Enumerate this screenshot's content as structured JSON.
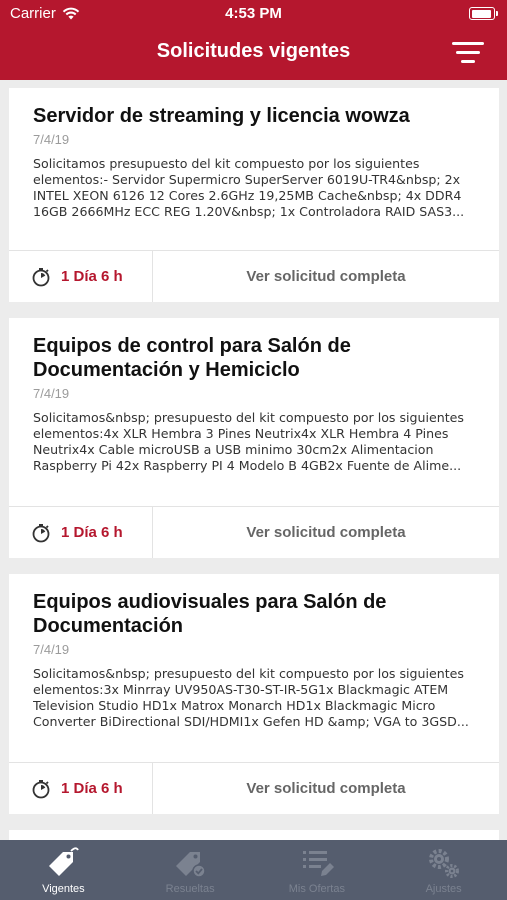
{
  "status_bar": {
    "carrier": "Carrier",
    "time": "4:53 PM",
    "wifi_icon": "wifi-icon",
    "battery_icon": "battery-icon"
  },
  "header": {
    "title": "Solicitudes vigentes",
    "filter_icon": "filter-icon",
    "background": "#b5172e"
  },
  "requests": [
    {
      "title": "Servidor de streaming y licencia wowza",
      "date": "7/4/19",
      "description": "Solicitamos presupuesto del kit compuesto por los siguientes elementos:- Servidor Supermicro SuperServer 6019U-TR4&nbsp; 2x INTEL XEON 6126 12 Cores 2.6GHz 19,25MB Cache&nbsp; 4x DDR4 16GB 2666MHz ECC REG 1.20V&nbsp; 1x Controladora RAID SAS3...",
      "time_left": "1 Día 6 h",
      "action_label": "Ver solicitud completa"
    },
    {
      "title": "Equipos de control para Salón de Documentación y Hemiciclo",
      "date": "7/4/19",
      "description": "Solicitamos&nbsp; presupuesto del kit compuesto por los siguientes elementos:4x XLR Hembra 3 Pines Neutrix4x XLR Hembra 4 Pines Neutrix4x Cable microUSB a USB minimo 30cm2x Alimentacion Raspberry Pi 42x Raspberry PI 4 Modelo B 4GB2x Fuente de Alime...",
      "time_left": "1 Día 6 h",
      "action_label": "Ver solicitud completa"
    },
    {
      "title": "Equipos audiovisuales para Salón de Documentación",
      "date": "7/4/19",
      "description": "Solicitamos&nbsp; presupuesto del kit compuesto por los siguientes elementos:3x Minrray UV950AS-T30-ST-IR-5G1x Blackmagic ATEM Television Studio HD1x Matrox Monarch HD1x Blackmagic Micro Converter BiDirectional SDI/HDMI1x Gefen HD &amp; VGA to 3GSD...",
      "time_left": "1 Día 6 h",
      "action_label": "Ver solicitud completa"
    }
  ],
  "tabs": [
    {
      "label": "Vigentes",
      "icon": "tag-icon",
      "active": true
    },
    {
      "label": "Resueltas",
      "icon": "tag-check-icon",
      "active": false
    },
    {
      "label": "Mis Ofertas",
      "icon": "list-edit-icon",
      "active": false
    },
    {
      "label": "Ajustes",
      "icon": "gears-icon",
      "active": false
    }
  ],
  "colors": {
    "accent": "#b5172e",
    "tab_bar": "#555d6e",
    "tab_active": "#ffffff",
    "tab_inactive": "#7b8290"
  }
}
